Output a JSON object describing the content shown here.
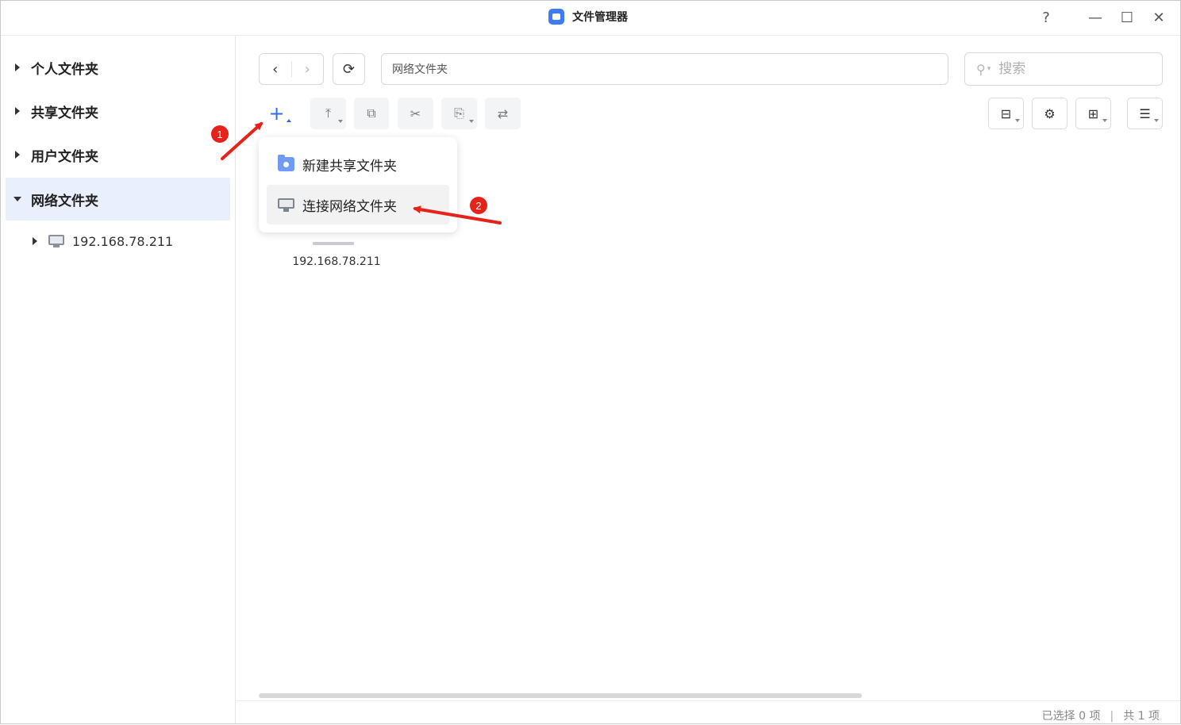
{
  "titlebar": {
    "app_title": "文件管理器",
    "app_icon": "folder-icon",
    "help_label": "?",
    "minimize_label": "—",
    "maximize_label": "☐",
    "close_label": "✕"
  },
  "sidebar": {
    "items": [
      {
        "label": "个人文件夹",
        "expanded": false,
        "active": false
      },
      {
        "label": "共享文件夹",
        "expanded": false,
        "active": false
      },
      {
        "label": "用户文件夹",
        "expanded": false,
        "active": false
      },
      {
        "label": "网络文件夹",
        "expanded": true,
        "active": true
      }
    ],
    "sub_item": {
      "label": "192.168.78.211",
      "icon": "computer-icon"
    }
  },
  "toolbar": {
    "back_label": "‹",
    "forward_label": "›",
    "refresh_label": "⟳",
    "path": "网络文件夹",
    "search_placeholder": "搜索",
    "search_icon": "search-icon",
    "new_label": "+",
    "upload_label": "⤒",
    "copy_label": "⧉",
    "cut_label": "✂",
    "paste_label": "⎘",
    "move_label": "⇄",
    "tools_label": "⊟",
    "settings_label": "⚙",
    "view_label": "⊞",
    "sort_label": "☰"
  },
  "content": {
    "items": [
      {
        "label": "192.168.78.211",
        "icon": "computer-icon"
      }
    ]
  },
  "new_menu": {
    "items": [
      {
        "label": "新建共享文件夹",
        "icon": "shared-folder-icon"
      },
      {
        "label": "连接网络文件夹",
        "icon": "network-computer-icon"
      }
    ]
  },
  "annotations": {
    "step1": "1",
    "step2": "2",
    "color": "#e5231b"
  },
  "status": {
    "selected": "已选择 0 项",
    "separator": "|",
    "total": "共 1 项"
  },
  "colors": {
    "accent": "#2f6bf2",
    "active_bg": "#e9effd"
  }
}
